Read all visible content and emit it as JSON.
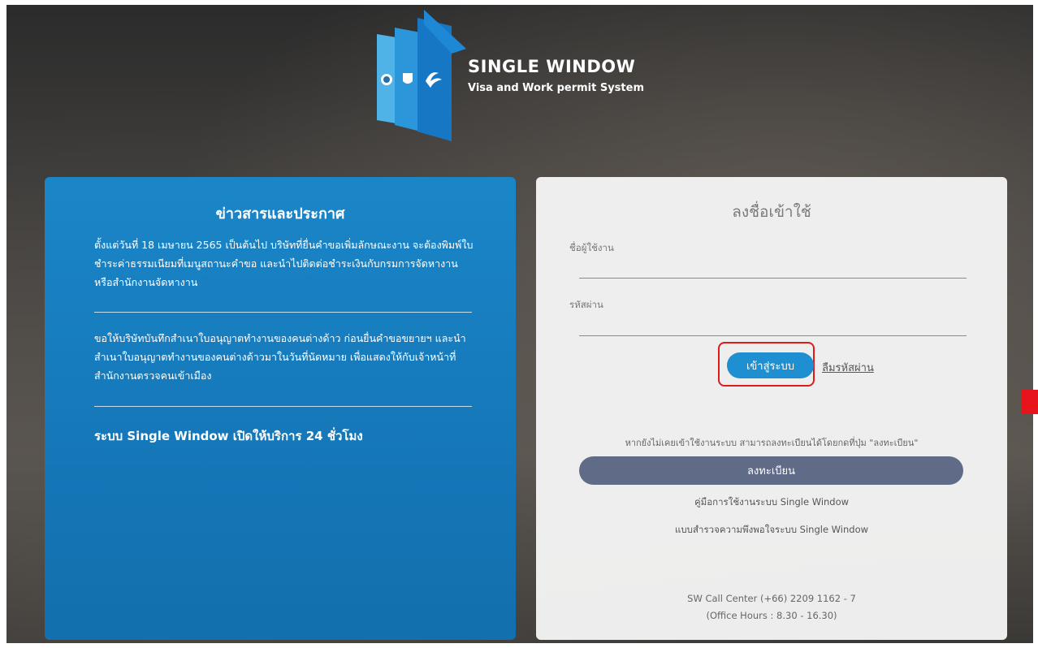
{
  "brand": {
    "title": "SINGLE WINDOW",
    "subtitle": "Visa and Work permit System"
  },
  "news": {
    "heading": "ข่าวสารและประกาศ",
    "items": [
      "ตั้งแต่วันที่ 18 เมษายน 2565 เป็นต้นไป บริษัทที่ยื่นคำขอเพิ่มลักษณะงาน จะต้องพิมพ์ใบชำระค่าธรรมเนียมที่เมนูสถานะคำขอ และนำไปติดต่อชำระเงินกับกรมการจัดหางาน หรือสำนักงานจัดหางาน",
      "ขอให้บริษัทบันทึกสำเนาใบอนุญาตทำงานของคนต่างด้าว ก่อนยื่นคำขอขยายฯ และนำสำเนาใบอนุญาตทำงานของคนต่างด้าวมาในวันที่นัดหมาย เพื่อแสดงให้กับเจ้าหน้าที่สำนักงานตรวจคนเข้าเมือง",
      "ระบบ Single Window เปิดให้บริการ 24 ชั่วโมง"
    ]
  },
  "login": {
    "heading": "ลงชื่อเข้าใช้",
    "username_label": "ชื่อผู้ใช้งาน",
    "username_value": "",
    "password_label": "รหัสผ่าน",
    "password_value": "",
    "login_button": "เข้าสู่ระบบ",
    "forgot_link": "ลืมรหัสผ่าน",
    "register_hint": "หากยังไม่เคยเข้าใช้งานระบบ สามารถลงทะเบียนได้โดยกดที่ปุ่ม \"ลงทะเบียน\"",
    "register_button": "ลงทะเบียน",
    "manual_link": "คู่มือการใช้งานระบบ Single Window",
    "survey_link": "แบบสำรวจความพึงพอใจระบบ Single Window",
    "call_center": "SW Call Center (+66) 2209 1162 - 7",
    "office_hours": "(Office Hours : 8.30 - 16.30)"
  },
  "colors": {
    "news_panel": "#1a86c8",
    "login_button": "#1e8fd0",
    "register_button": "#5f6b87",
    "highlight": "#e01a1a"
  }
}
